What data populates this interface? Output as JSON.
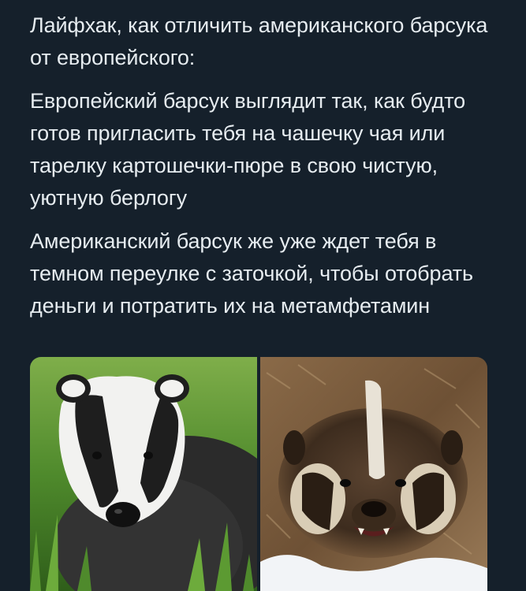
{
  "tweet": {
    "paragraph1": "Лайфхак, как отличить американского барсука от европейского:",
    "paragraph2": "Европейский барсук выглядит так, как будто готов пригласить тебя на чашечку чая или тарелку картошечки-пюре в свою чистую, уютную берлогу",
    "paragraph3": "Американский барсук же уже ждет тебя в темном переулке с заточкой, чтобы отобрать деньги и потратить их на метамфетамин"
  },
  "colors": {
    "background": "#15202b",
    "text": "#e6ecf0"
  }
}
